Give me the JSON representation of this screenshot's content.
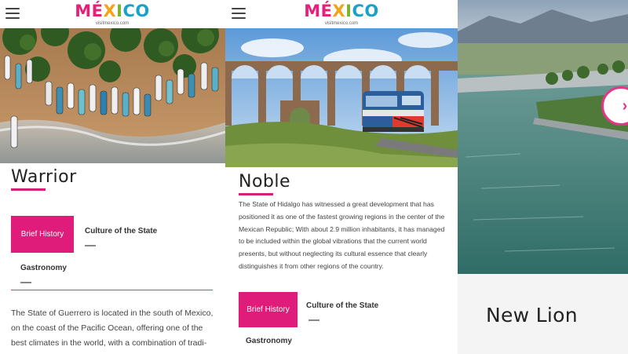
{
  "brand": {
    "logo_letters": [
      "M",
      "É",
      "X",
      "I",
      "C",
      "O"
    ],
    "logo_colors": [
      "#e4207a",
      "#e4207a",
      "#f6a118",
      "#7bb431",
      "#1aa1c9",
      "#1aa1c9"
    ],
    "site": "visitmexico.com"
  },
  "panel_warrior": {
    "title": "Warrior",
    "tabs": {
      "brief_history": "Brief History",
      "culture": "Culture of the State",
      "gastronomy": "Gastronomy"
    },
    "body": "The State of Guerrero is located in the south of Mexico, on the coast of the Pacific Ocean, offering one of the best climates in the world, with a combination of tradi-"
  },
  "panel_noble": {
    "title": "Noble",
    "body": "The State of Hidalgo has witnessed a great development that has positioned it as one of the fastest growing regions in the center of the Mexican Republic; With about 2.9 million inhabitants, it has managed to be included within the global vibrations that the current world presents, but without neglecting its cultural essence that clearly distinguishes it from other regions of the country.",
    "tabs": {
      "brief_history": "Brief History",
      "culture": "Culture of the State",
      "gastronomy": "Gastronomy"
    }
  },
  "panel_newlion": {
    "title": "New Lion",
    "next_glyph": "›"
  },
  "colors": {
    "accent": "#e01c7a"
  },
  "icons": {
    "menu": "hamburger-menu-icon",
    "next": "chevron-right-icon"
  }
}
